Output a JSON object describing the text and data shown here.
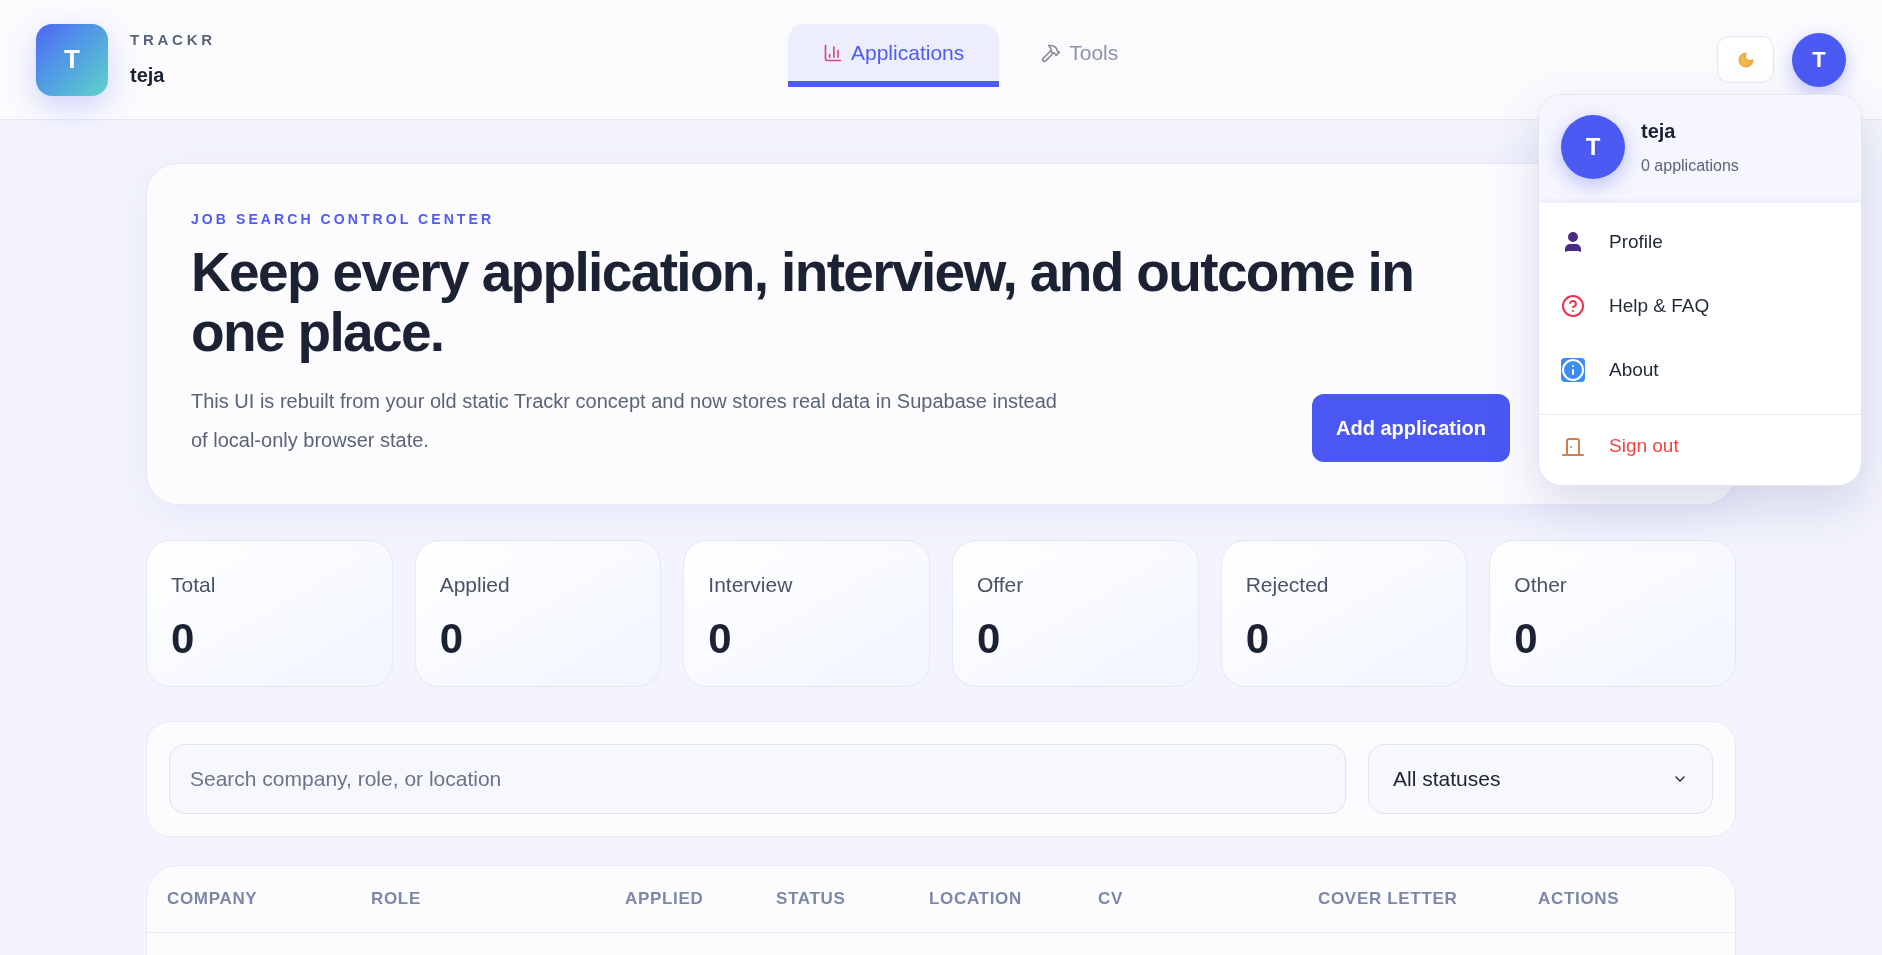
{
  "brand": {
    "logo_letter": "T",
    "name": "TRACKR",
    "user": "teja"
  },
  "nav_tabs": [
    {
      "label": "Applications",
      "kind": "chart",
      "selected": true
    },
    {
      "label": "Tools",
      "kind": "tools",
      "selected": false
    }
  ],
  "avatar_letter": "T",
  "user_menu": {
    "avatar_letter": "T",
    "name": "teja",
    "subtitle": "0 applications",
    "items": [
      {
        "label": "Profile",
        "kind": "profile"
      },
      {
        "label": "Help & FAQ",
        "kind": "help"
      },
      {
        "label": "About",
        "kind": "about"
      },
      {
        "label": "Sign out",
        "kind": "sign_out"
      }
    ]
  },
  "hero": {
    "eyebrow": "JOB SEARCH CONTROL CENTER",
    "title": "Keep every application, interview, and outcome in one place.",
    "description": "This UI is rebuilt from your old static Trackr concept and now stores real data in Supabase instead of local-only browser state.",
    "button": "Add application"
  },
  "stats": [
    {
      "label": "Total",
      "value": "0"
    },
    {
      "label": "Applied",
      "value": "0"
    },
    {
      "label": "Interview",
      "value": "0"
    },
    {
      "label": "Offer",
      "value": "0"
    },
    {
      "label": "Rejected",
      "value": "0"
    },
    {
      "label": "Other",
      "value": "0"
    }
  ],
  "filters": {
    "search_placeholder": "Search company, role, or location",
    "status_select": "All statuses"
  },
  "table": {
    "columns": [
      "COMPANY",
      "ROLE",
      "APPLIED",
      "STATUS",
      "LOCATION",
      "CV",
      "COVER LETTER",
      "ACTIONS"
    ]
  }
}
